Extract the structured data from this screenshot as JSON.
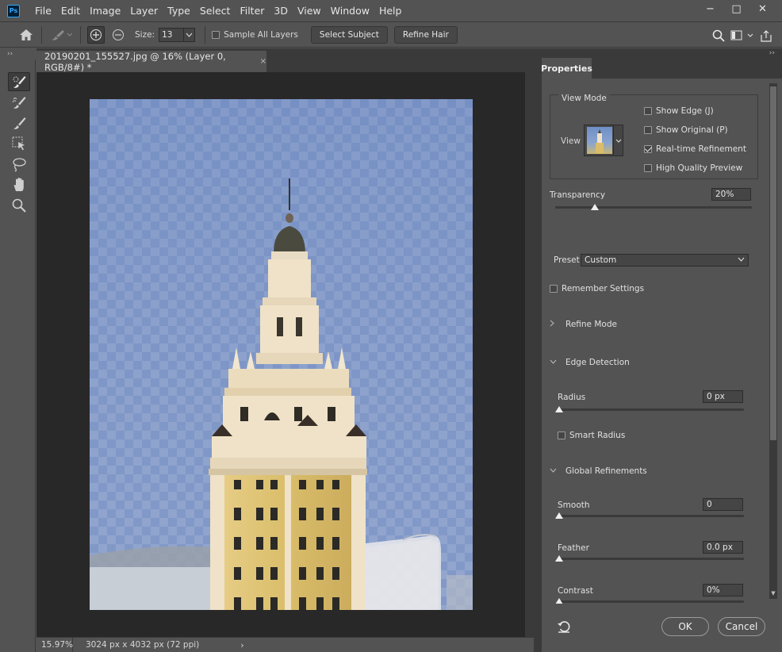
{
  "app": {
    "logo": "Ps",
    "menu": [
      "File",
      "Edit",
      "Image",
      "Layer",
      "Type",
      "Select",
      "Filter",
      "3D",
      "View",
      "Window",
      "Help"
    ],
    "window_controls": [
      "−",
      "□",
      "✕"
    ]
  },
  "options": {
    "size_label": "Size:",
    "size_value": "13",
    "sample_all_layers": "Sample All Layers",
    "sample_all_checked": false,
    "select_subject": "Select Subject",
    "refine_hair": "Refine Hair"
  },
  "toolbar": {
    "collapse": "››",
    "tools": [
      "quick-selection-icon",
      "refine-edge-brush-icon",
      "brush-icon",
      "object-selection-icon",
      "lasso-icon",
      "hand-icon",
      "zoom-icon"
    ]
  },
  "document": {
    "tab_title": "20190201_155527.jpg @ 16% (Layer 0, RGB/8#) *",
    "tab_close": "×",
    "status_zoom": "15.97%",
    "status_dims": "3024 px x 4032 px (72 ppi)",
    "status_arrow": "›"
  },
  "panel": {
    "collapse": "››",
    "tab": "Properties",
    "view_mode_title": "View Mode",
    "view_label": "View",
    "show_edge": "Show Edge (J)",
    "show_original": "Show Original (P)",
    "realtime_refinement": "Real-time Refinement",
    "high_quality_preview": "High Quality Preview",
    "show_edge_checked": false,
    "show_original_checked": false,
    "realtime_checked": true,
    "hq_checked": false,
    "transparency_label": "Transparency",
    "transparency_value": "20%",
    "transparency_level": 20,
    "preset_label": "Preset",
    "preset_value": "Custom",
    "remember_settings": "Remember Settings",
    "remember_checked": false,
    "refine_mode": "Refine Mode",
    "edge_detection": "Edge Detection",
    "radius_label": "Radius",
    "radius_value": "0 px",
    "smart_radius": "Smart Radius",
    "smart_radius_checked": false,
    "global_refinements": "Global Refinements",
    "smooth_label": "Smooth",
    "smooth_value": "0",
    "feather_label": "Feather",
    "feather_value": "0.0 px",
    "contrast_label": "Contrast",
    "contrast_value": "0%",
    "ok": "OK",
    "cancel": "Cancel"
  },
  "colors": {
    "ui_bg": "#535353",
    "dark": "#3a3a3a",
    "canvas": "#282828",
    "accent": "#31a8ff"
  }
}
